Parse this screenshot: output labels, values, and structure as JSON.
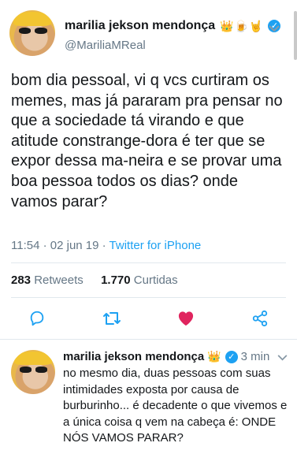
{
  "main_tweet": {
    "display_name": "marilia jekson mendonça",
    "name_emojis": "👑🍺🤘",
    "handle": "@MariliaMReal",
    "text": "bom dia pessoal, vi q vcs curtiram os memes, mas já pararam pra pensar no que a sociedade tá virando e que atitude constrange-dora é ter que se expor dessa ma-neira e se provar uma boa pessoa todos os dias? onde vamos parar?",
    "time_date": "11:54 · 02 jun 19 · ",
    "source": "Twitter for iPhone",
    "retweets_count": "283",
    "retweets_label": "Retweets",
    "likes_count": "1.770",
    "likes_label": "Curtidas",
    "colors": {
      "accent": "#1da1f2",
      "like": "#e0245e",
      "muted": "#657786"
    },
    "icons": [
      "reply-icon",
      "retweet-icon",
      "like-heart-icon",
      "share-icon"
    ]
  },
  "reply_tweet": {
    "display_name": "marilia jekson mendonça",
    "name_emojis": "👑",
    "time_ago": "3 min",
    "text": "no mesmo dia, duas pessoas com suas intimidades exposta por causa de burburinho... é decadente o que vivemos e a única coisa q vem na cabeça é: ONDE NÓS VAMOS PARAR?"
  }
}
